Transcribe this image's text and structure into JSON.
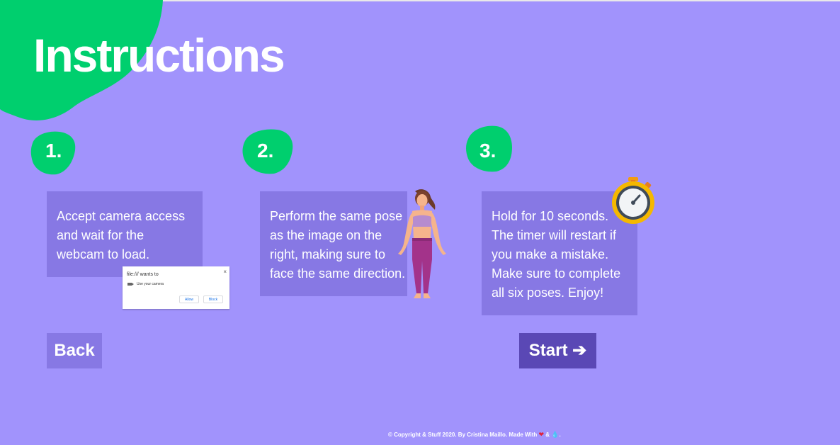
{
  "header": {
    "title": "Instructions"
  },
  "steps": [
    {
      "number": "1.",
      "lines": [
        "Accept camera access",
        "and wait for the",
        "webcam to load."
      ]
    },
    {
      "number": "2.",
      "lines": [
        "Perform the same pose",
        "as the image on the",
        "right, making sure to",
        "face the same direction."
      ]
    },
    {
      "number": "3.",
      "lines": [
        "Hold for 10 seconds.",
        "The timer will restart if",
        "you make a mistake.",
        "Make sure to complete",
        "all six poses. Enjoy!"
      ]
    }
  ],
  "permission_dialog": {
    "title": "file:/// wants to",
    "permission": "Use your camera",
    "allow_label": "Allow",
    "block_label": "Block",
    "close_glyph": "×"
  },
  "buttons": {
    "back_label": "Back",
    "start_label": "Start ➔"
  },
  "footer": {
    "text": "© Copyright & Stuff 2020. By Cristina Maillo. Made With",
    "heart": "❤",
    "amp": " & ",
    "drop": "💧",
    "end": "."
  },
  "colors": {
    "background": "#a193fc",
    "accent_green": "#00cf6e",
    "card": "#8778e4",
    "start_button": "#5a48b5"
  },
  "icons": [
    "stopwatch-icon",
    "woman-pose-illustration",
    "camera-icon",
    "heart-icon",
    "water-drop-icon"
  ]
}
